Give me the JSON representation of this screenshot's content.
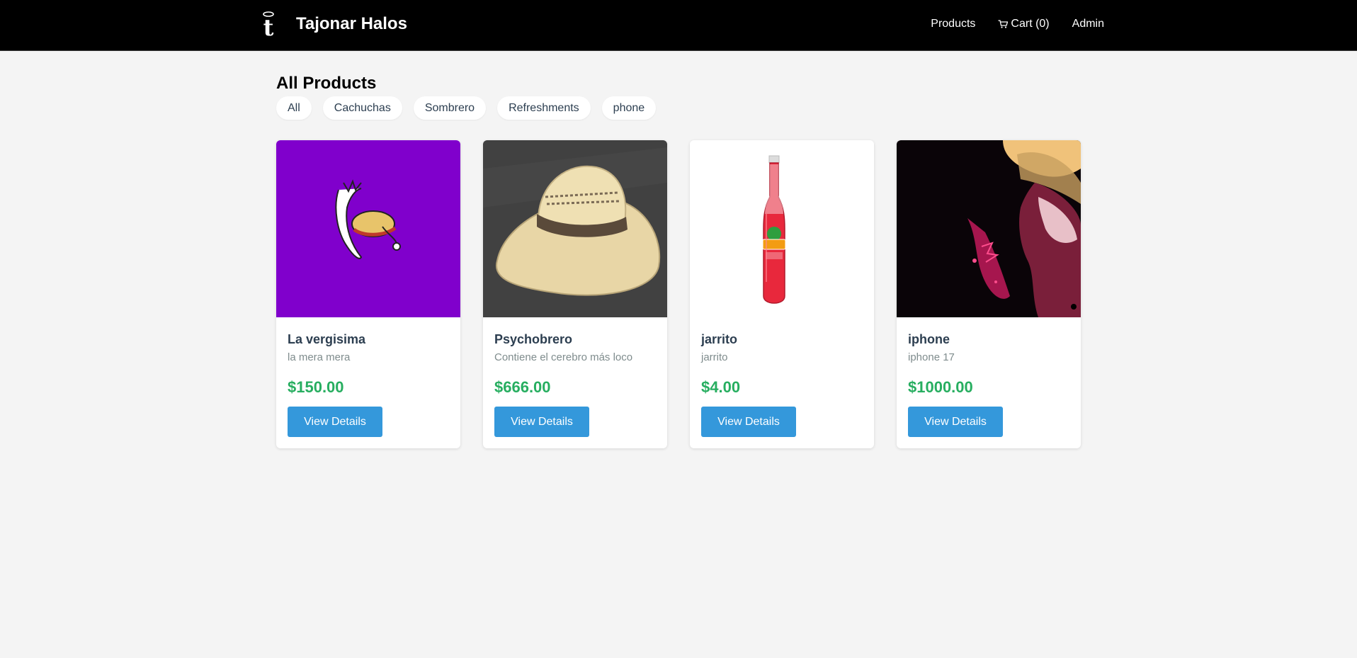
{
  "header": {
    "brand_name": "Tajonar Halos",
    "logo_icon": "t-hat-logo-icon",
    "nav": {
      "products_label": "Products",
      "cart_label": "Cart (0)",
      "cart_icon": "cart-icon",
      "admin_label": "Admin"
    }
  },
  "main": {
    "title": "All Products",
    "filters": [
      "All",
      "Cachuchas",
      "Sombrero",
      "Refreshments",
      "phone"
    ],
    "products": [
      {
        "name": "La vergisima",
        "description": "la mera mera",
        "price": "$150.00",
        "button_label": "View Details"
      },
      {
        "name": "Psychobrero",
        "description": "Contiene el cerebro más loco",
        "price": "$666.00",
        "button_label": "View Details"
      },
      {
        "name": "jarrito",
        "description": "jarrito",
        "price": "$4.00",
        "button_label": "View Details"
      },
      {
        "name": "iphone",
        "description": "iphone 17",
        "price": "$1000.00",
        "button_label": "View Details"
      }
    ]
  },
  "colors": {
    "navbar_bg": "#000000",
    "page_bg": "#f4f4f4",
    "price_green": "#27ae60",
    "button_blue": "#3498db",
    "product1_bg": "#8000cc"
  }
}
